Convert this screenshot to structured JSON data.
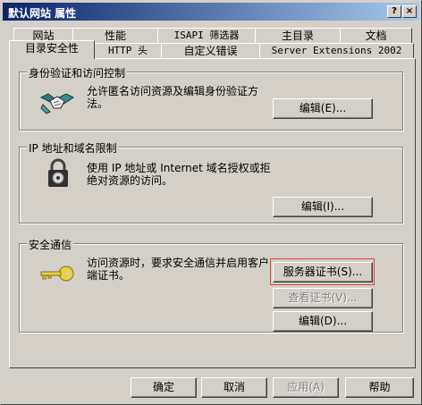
{
  "window": {
    "title": "默认网站 属性",
    "help_button": "?",
    "close_button": "×"
  },
  "tabs_back_row": [
    "网站",
    "性能",
    "ISAPI 筛选器",
    "主目录",
    "文档"
  ],
  "tabs_front_row": [
    "目录安全性",
    "HTTP 头",
    "自定义错误",
    "Server Extensions 2002"
  ],
  "groups": {
    "auth": {
      "title": "身份验证和访问控制",
      "description": "允许匿名访问资源及编辑身份验证方法。",
      "edit_button": "编辑(E)..."
    },
    "ip": {
      "title": "IP 地址和域名限制",
      "description": "使用 IP 地址或 Internet 域名授权或拒绝对资源的访问。",
      "edit_button": "编辑(I)..."
    },
    "secure": {
      "title": "安全通信",
      "description": "访问资源时，要求安全通信并启用客户端证书。",
      "server_cert_button": "服务器证书(S)...",
      "view_cert_button": "查看证书(V)...",
      "edit_button": "编辑(D)..."
    }
  },
  "footer": {
    "ok": "确定",
    "cancel": "取消",
    "apply": "应用(A)",
    "help": "帮助"
  }
}
